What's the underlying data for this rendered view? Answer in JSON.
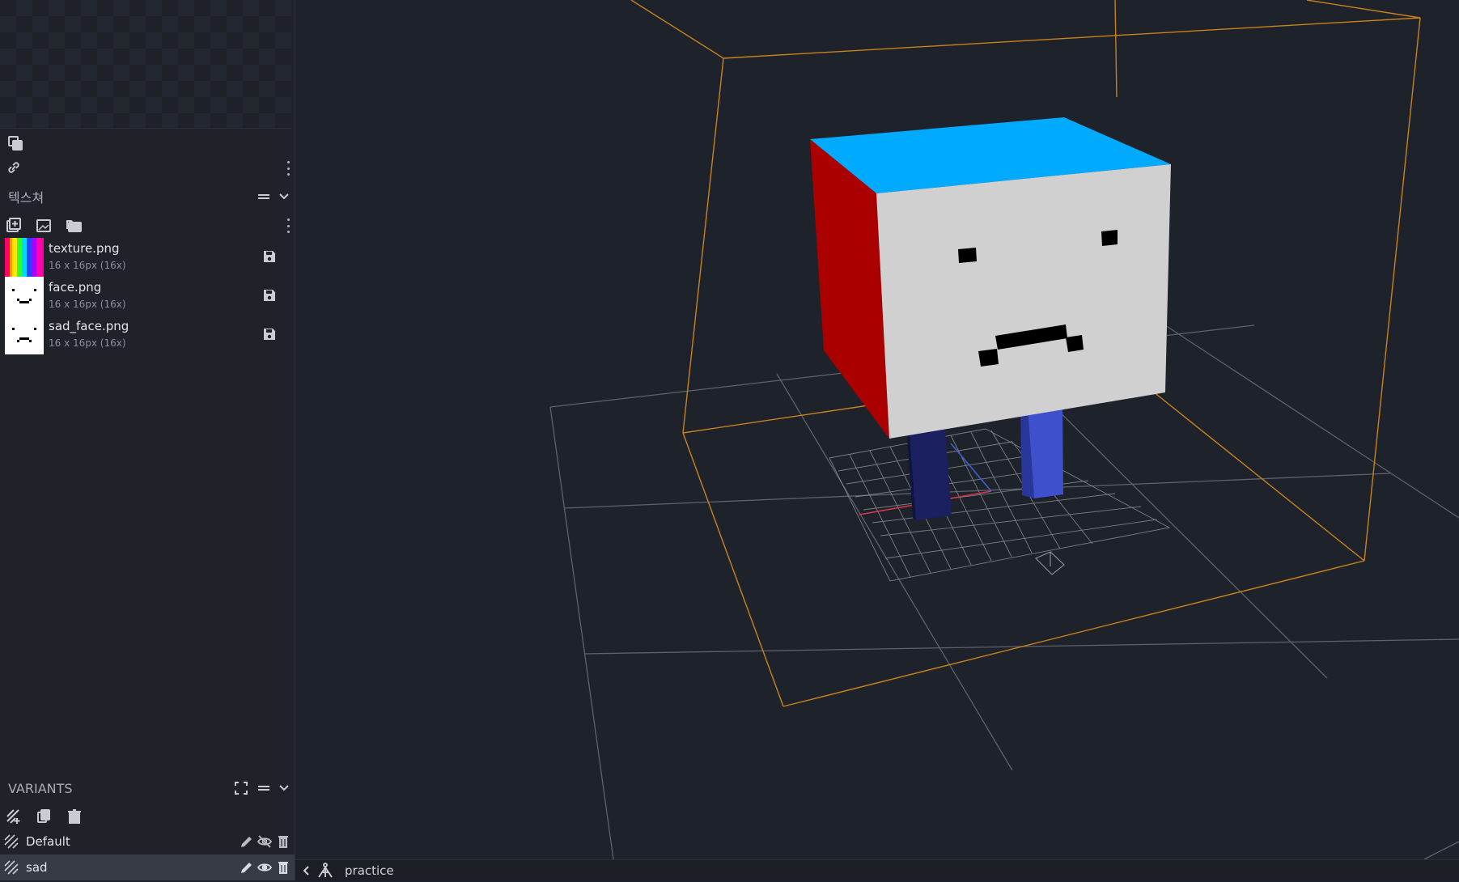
{
  "texture_panel": {
    "title": "텍스쳐",
    "toolbar": {
      "add_icon": "add-texture-icon",
      "import_icon": "import-texture-icon",
      "folder_icon": "texture-folder-icon"
    },
    "items": [
      {
        "name": "texture.png",
        "meta": "16 x 16px (16x)",
        "thumb": "texture-stripes-icon"
      },
      {
        "name": "face.png",
        "meta": "16 x 16px (16x)",
        "thumb": "happy-face-icon"
      },
      {
        "name": "sad_face.png",
        "meta": "16 x 16px (16x)",
        "thumb": "sad-face-icon"
      }
    ]
  },
  "preview_toolbar": {
    "copy_icon": "copy-icon",
    "link_icon": "link-icon"
  },
  "variants_panel": {
    "title": "VARIANTS",
    "toolbar": {
      "add_icon": "add-variant-icon",
      "duplicate_icon": "duplicate-icon",
      "delete_icon": "delete-icon"
    },
    "items": [
      {
        "label": "Default",
        "visible": false
      },
      {
        "label": "sad",
        "visible": true,
        "selected": true
      }
    ]
  },
  "viewport": {
    "head_colors": {
      "top": "#00aaff",
      "left": "#aa0000",
      "front": "#d0d0d0"
    },
    "leg_colors": {
      "left": "#1a2060",
      "right": "#3f50cc"
    },
    "bounding_box_color": "#c8821e",
    "grid_color": "#60646e"
  },
  "statusbar": {
    "project_name": "practice"
  }
}
